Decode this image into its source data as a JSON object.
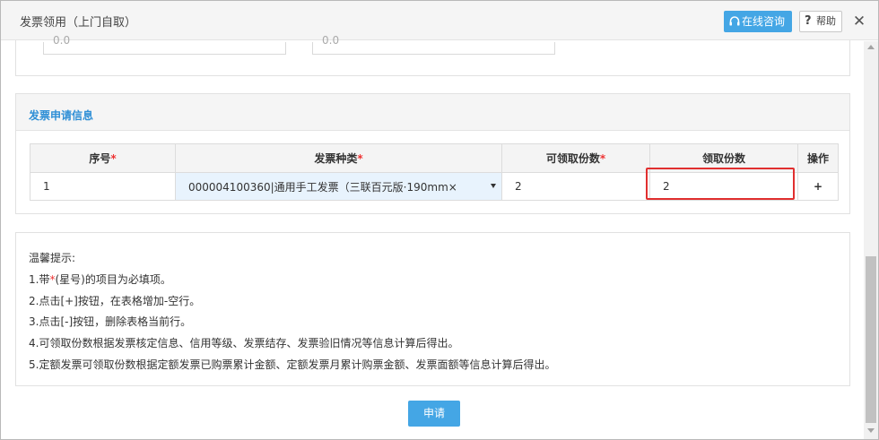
{
  "window": {
    "title": "发票领用（上门自取）"
  },
  "header": {
    "online_label": "在线咨询",
    "help_label": "帮助",
    "close_label": "✕"
  },
  "top_fields": {
    "value_left": "0.0",
    "value_right": "0.0"
  },
  "apply": {
    "section_title": "发票申请信息",
    "required_mark": "*",
    "columns": {
      "seq": "序号",
      "type": "发票种类",
      "available": "可领取份数",
      "quantity": "领取份数",
      "action": "操作"
    },
    "row": {
      "seq": "1",
      "type": "000004100360|通用手工发票（三联百元版·190mm×",
      "available": "2",
      "quantity": "2",
      "action": "+"
    }
  },
  "tips": {
    "title": "温馨提示:",
    "line1_prefix": "1.带",
    "line1_star": "*",
    "line1_suffix": "(星号)的项目为必填项。",
    "lines": [
      "2.点击[+]按钮，在表格增加-空行。",
      "3.点击[-]按钮，删除表格当前行。",
      "4.可领取份数根据发票核定信息、信用等级、发票结存、发票验旧情况等信息计算后得出。",
      "5.定额发票可领取份数根据定额发票已购票累计金额、定额发票月累计购票金额、发票面额等信息计算后得出。"
    ]
  },
  "footer": {
    "submit_label": "申请"
  },
  "colors": {
    "accent": "#44a6e5",
    "section_title": "#2f8fd6",
    "required": "#e33333",
    "highlight": "#e12f2f"
  }
}
